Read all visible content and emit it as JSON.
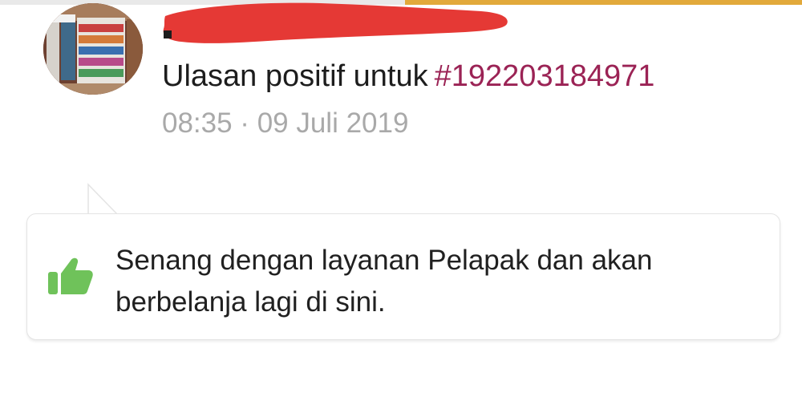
{
  "review": {
    "title_prefix": "Ulasan positif untuk",
    "order_id": "#192203184971",
    "timestamp": "08:35 · 09 Juli 2019",
    "message": "Senang dengan layanan Pelapak dan akan berbelanja lagi di sini.",
    "sentiment_icon": "thumbs-up-icon"
  },
  "colors": {
    "order_link": "#9b2355",
    "timestamp": "#a9a9a9",
    "thumb_icon": "#6fc25a",
    "redaction": "#e53935",
    "top_accent": "#e2a93b"
  }
}
